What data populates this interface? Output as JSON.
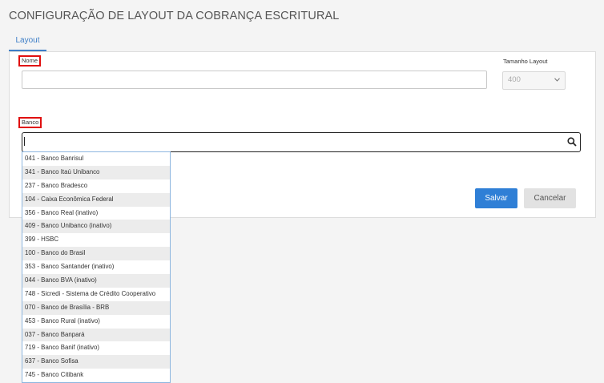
{
  "page": {
    "title": "CONFIGURAÇÃO DE LAYOUT DA COBRANÇA ESCRITURAL"
  },
  "tabs": [
    {
      "label": "Layout"
    }
  ],
  "form": {
    "nome": {
      "label": "Nome",
      "value": ""
    },
    "tamanho_layout": {
      "label": "Tamanho Layout",
      "value": "400"
    },
    "banco": {
      "label": "Banco",
      "value": ""
    }
  },
  "actions": {
    "save_label": "Salvar",
    "cancel_label": "Cancelar"
  },
  "banco_options": [
    "041 - Banco Banrisul",
    "341 - Banco Itaú Unibanco",
    "237 - Banco Bradesco",
    "104 - Caixa Econômica Federal",
    "356 - Banco Real (inativo)",
    "409 - Banco Unibanco (inativo)",
    "399 - HSBC",
    "100 - Banco do Brasil",
    "353 - Banco Santander (inativo)",
    "044 - Banco BVA (inativo)",
    "748 - Sicredi - Sistema de Crédito Cooperativo",
    "070 - Banco de Brasília - BRB",
    "453 - Banco Rural (inativo)",
    "037 - Banco Banpará",
    "719 - Banco Banif (inativo)",
    "637 - Banco Sofisa",
    "745 - Banco Citibank"
  ],
  "colors": {
    "accent": "#3d7ec7",
    "save_button": "#2f7fd6",
    "highlight_border": "#e01010"
  }
}
